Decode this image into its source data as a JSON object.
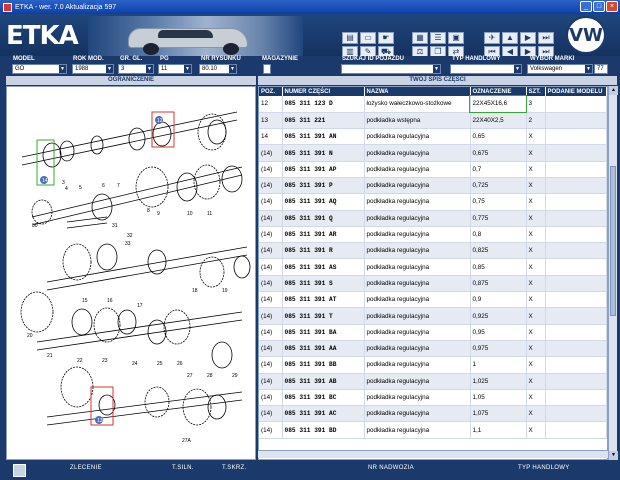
{
  "window": {
    "title": "ETKA - wer. 7.0 Aktualizacja 597",
    "btn_min": "_",
    "btn_max": "□",
    "btn_close": "×"
  },
  "header": {
    "logo": "ETKA",
    "brand_logo": "VW"
  },
  "toolbar": {
    "icons": [
      "printer-icon",
      "screen-icon",
      "hand-icon",
      "print-doc-icon",
      "edit-icon",
      "car-icon",
      "window-grid-icon",
      "window-list-icon",
      "filter-icon",
      "scale-icon",
      "pin-icon",
      "first-icon",
      "prev-icon",
      "next-icon",
      "last-icon"
    ]
  },
  "fields": {
    "model_label": "MODEL",
    "model_value": "GO",
    "year_label": "ROK MOD.",
    "year_value": "1988",
    "group_label": "GR. GL.",
    "group_value": "3",
    "pg_label": "PG",
    "pg_value": "11",
    "drawing_label": "NR RYSUNKU",
    "drawing_value": "80.10",
    "warehouse_label": "MAGAZYNIE",
    "vin_label": "SZUKAJ ID POJAZDU",
    "vin_value": "",
    "trade_label": "TYP HANDLOWY",
    "trade_value": "",
    "brand_label": "WYBÓR MARKI",
    "brand_value": "Volkswagen",
    "brand_num": "77"
  },
  "sections": {
    "left": "OGRANICZENIE",
    "right": "TWÓJ SPIS CZĘŚCI"
  },
  "table": {
    "columns": [
      "POZ.",
      "NUMER CZĘŚCI",
      "NAZWA",
      "OZNACZENIE",
      "SZT.",
      "PODANIE MODELU"
    ],
    "rows": [
      [
        "12",
        "085  311  123  D",
        "łożysko wałeczkowo-stożkowe",
        "22X45X16,6",
        "3",
        ""
      ],
      [
        "13",
        "085  311  221",
        "podkładka wstępna",
        "22X40X2,5",
        "2",
        ""
      ],
      [
        "14",
        "085  311  391  AN",
        "podkładka regulacyjna",
        "0,65",
        "X",
        ""
      ],
      [
        "(14)",
        "085  311  391  N",
        "podkładka regulacyjna",
        "0,675",
        "X",
        ""
      ],
      [
        "(14)",
        "085  311  391  AP",
        "podkładka regulacyjna",
        "0,7",
        "X",
        ""
      ],
      [
        "(14)",
        "085  311  391  P",
        "podkładka regulacyjna",
        "0,725",
        "X",
        ""
      ],
      [
        "(14)",
        "085  311  391  AQ",
        "podkładka regulacyjna",
        "0,75",
        "X",
        ""
      ],
      [
        "(14)",
        "085  311  391  Q",
        "podkładka regulacyjna",
        "0,775",
        "X",
        ""
      ],
      [
        "(14)",
        "085  311  391  AR",
        "podkładka regulacyjna",
        "0,8",
        "X",
        ""
      ],
      [
        "(14)",
        "085  311  391  R",
        "podkładka regulacyjna",
        "0,825",
        "X",
        ""
      ],
      [
        "(14)",
        "085  311  391  AS",
        "podkładka regulacyjna",
        "0,85",
        "X",
        ""
      ],
      [
        "(14)",
        "085  311  391  S",
        "podkładka regulacyjna",
        "0,875",
        "X",
        ""
      ],
      [
        "(14)",
        "085  311  391  AT",
        "podkładka regulacyjna",
        "0,9",
        "X",
        ""
      ],
      [
        "(14)",
        "085  311  391  T",
        "podkładka regulacyjna",
        "0,925",
        "X",
        ""
      ],
      [
        "(14)",
        "085  311  391  BA",
        "podkładka regulacyjna",
        "0,95",
        "X",
        ""
      ],
      [
        "(14)",
        "085  311  391  AA",
        "podkładka regulacyjna",
        "0,975",
        "X",
        ""
      ],
      [
        "(14)",
        "085  311  391  BB",
        "podkładka regulacyjna",
        "1",
        "X",
        ""
      ],
      [
        "(14)",
        "085  311  391  AB",
        "podkładka regulacyjna",
        "1,025",
        "X",
        ""
      ],
      [
        "(14)",
        "085  311  391  BC",
        "podkładka regulacyjna",
        "1,05",
        "X",
        ""
      ],
      [
        "(14)",
        "085  311  391  AC",
        "podkładka regulacyjna",
        "1,075",
        "X",
        ""
      ],
      [
        "(14)",
        "085  311  391  BD",
        "podkładka regulacyjna",
        "1,1",
        "X",
        ""
      ]
    ]
  },
  "illustration": {
    "labels": [
      "12",
      "14",
      "13",
      "3",
      "4",
      "5",
      "6",
      "7",
      "8",
      "9",
      "10",
      "11",
      "30",
      "31",
      "32",
      "33",
      "27A",
      "17",
      "16",
      "15",
      "20",
      "21",
      "22",
      "23",
      "24",
      "25",
      "26",
      "27",
      "28",
      "29",
      "18",
      "19"
    ]
  },
  "footer": {
    "order": "ZLECENIE",
    "t_engine": "T.SILN.",
    "t_gearbox": "T.SKRZ.",
    "bodywork": "NR NADWOZIA",
    "trade_type": "TYP HANDLOWY"
  }
}
